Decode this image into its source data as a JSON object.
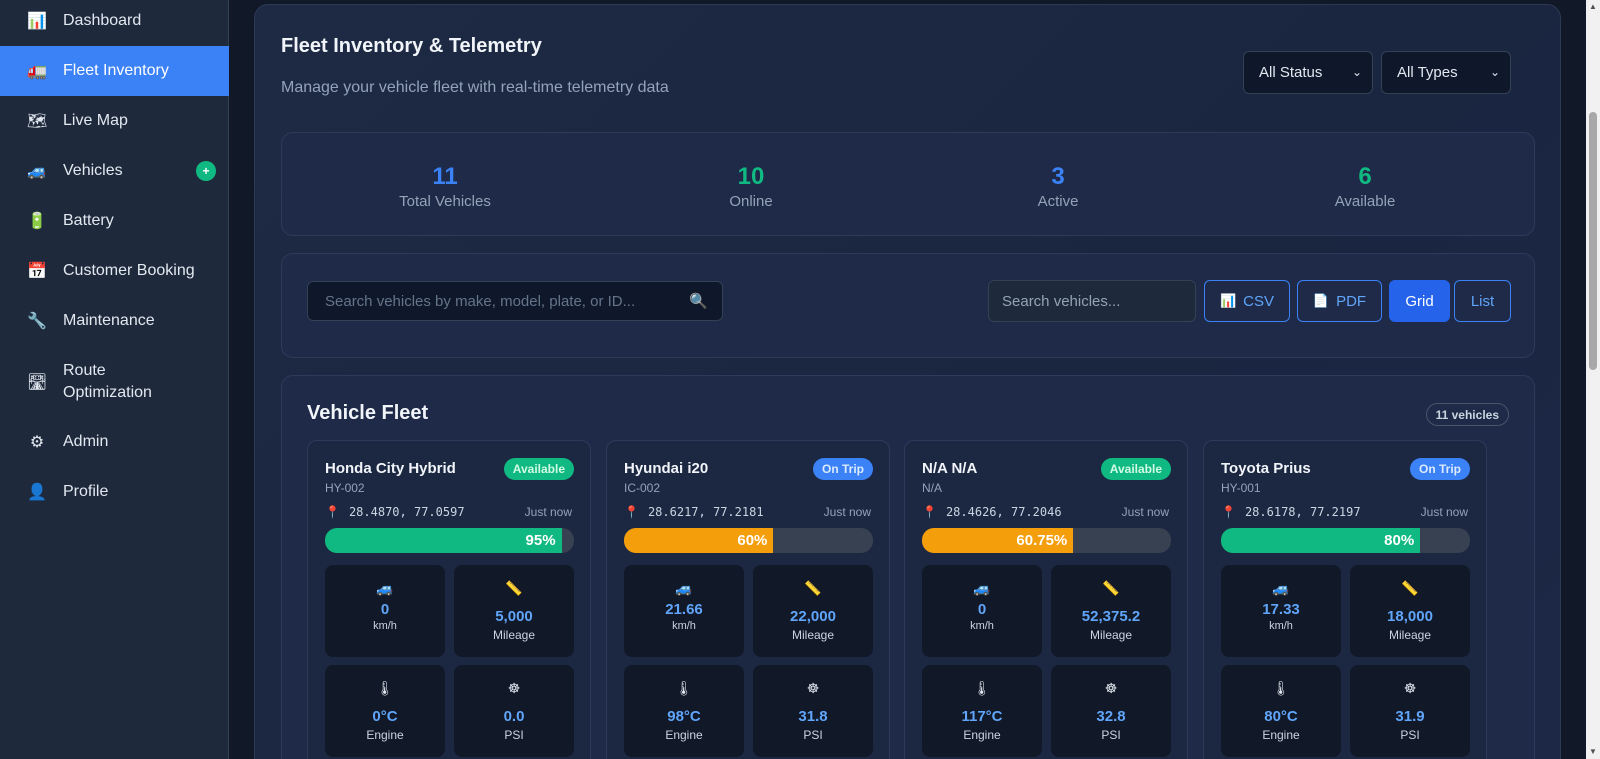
{
  "sidebar": {
    "items": [
      {
        "label": "Dashboard",
        "icon": "bar-chart-icon",
        "glyph": "📊"
      },
      {
        "label": "Fleet Inventory",
        "icon": "truck-icon",
        "glyph": "🚛"
      },
      {
        "label": "Live Map",
        "icon": "map-icon",
        "glyph": "🗺"
      },
      {
        "label": "Vehicles",
        "icon": "car-icon",
        "glyph": "🚙",
        "badge": "+"
      },
      {
        "label": "Battery",
        "icon": "battery-icon",
        "glyph": "🔋"
      },
      {
        "label": "Customer Booking",
        "icon": "calendar-icon",
        "glyph": "📅"
      },
      {
        "label": "Maintenance",
        "icon": "wrench-icon",
        "glyph": "🔧"
      },
      {
        "label": "Route Optimization",
        "icon": "route-map-icon",
        "glyph": "🛣"
      },
      {
        "label": "Admin",
        "icon": "gear-icon",
        "glyph": "⚙"
      },
      {
        "label": "Profile",
        "icon": "user-icon",
        "glyph": "👤"
      }
    ],
    "active_index": 1
  },
  "header": {
    "title": "Fleet Inventory & Telemetry",
    "subtitle": "Manage your vehicle fleet with real-time telemetry data",
    "status_filter": "All Status",
    "type_filter": "All Types"
  },
  "stats": [
    {
      "value": "11",
      "label": "Total Vehicles",
      "color": "#3b82f6"
    },
    {
      "value": "10",
      "label": "Online",
      "color": "#10b981"
    },
    {
      "value": "3",
      "label": "Active",
      "color": "#3b82f6"
    },
    {
      "value": "6",
      "label": "Available",
      "color": "#10b981"
    }
  ],
  "toolbar": {
    "search_placeholder": "Search vehicles by make, model, plate, or ID...",
    "quick_search_placeholder": "Search vehicles...",
    "csv_label": "CSV",
    "pdf_label": "PDF",
    "grid_label": "Grid",
    "list_label": "List"
  },
  "fleet": {
    "title": "Vehicle Fleet",
    "count_label": "11 vehicles",
    "vehicles": [
      {
        "name": "Honda City Hybrid",
        "id": "HY-002",
        "status": "Available",
        "coords": "28.4870, 77.0597",
        "updated": "Just now",
        "battery_pct": 95,
        "battery_label": "95%",
        "battery_color": "#10b981",
        "speed": "0",
        "speed_unit": "km/h",
        "mileage": "5,000",
        "mileage_label": "Mileage",
        "engine": "0°C",
        "engine_label": "Engine",
        "psi": "0.0",
        "psi_label": "PSI"
      },
      {
        "name": "Hyundai i20",
        "id": "IC-002",
        "status": "On Trip",
        "coords": "28.6217, 77.2181",
        "updated": "Just now",
        "battery_pct": 60,
        "battery_label": "60%",
        "battery_color": "#f59e0b",
        "speed": "21.66",
        "speed_unit": "km/h",
        "mileage": "22,000",
        "mileage_label": "Mileage",
        "engine": "98°C",
        "engine_label": "Engine",
        "psi": "31.8",
        "psi_label": "PSI"
      },
      {
        "name": "N/A N/A",
        "id": "N/A",
        "status": "Available",
        "coords": "28.4626, 77.2046",
        "updated": "Just now",
        "battery_pct": 60.75,
        "battery_label": "60.75%",
        "battery_color": "#f59e0b",
        "speed": "0",
        "speed_unit": "km/h",
        "mileage": "52,375.2",
        "mileage_label": "Mileage",
        "engine": "117°C",
        "engine_label": "Engine",
        "psi": "32.8",
        "psi_label": "PSI"
      },
      {
        "name": "Toyota Prius",
        "id": "HY-001",
        "status": "On Trip",
        "coords": "28.6178, 77.2197",
        "updated": "Just now",
        "battery_pct": 80,
        "battery_label": "80%",
        "battery_color": "#10b981",
        "speed": "17.33",
        "speed_unit": "km/h",
        "mileage": "18,000",
        "mileage_label": "Mileage",
        "engine": "80°C",
        "engine_label": "Engine",
        "psi": "31.9",
        "psi_label": "PSI"
      }
    ]
  }
}
